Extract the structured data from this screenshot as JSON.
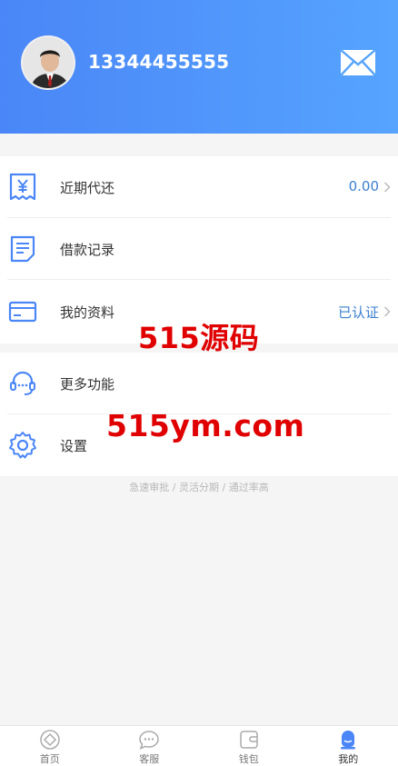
{
  "header": {
    "phone": "13344455555"
  },
  "menu_group_1": [
    {
      "label": "近期代还",
      "value": "0.00",
      "icon": "yuan-receipt-icon",
      "chevron": true
    },
    {
      "label": "借款记录",
      "value": "",
      "icon": "document-icon",
      "chevron": false
    },
    {
      "label": "我的资料",
      "value": "已认证",
      "icon": "card-icon",
      "chevron": true
    }
  ],
  "menu_group_2": [
    {
      "label": "更多功能",
      "icon": "headset-icon"
    },
    {
      "label": "设置",
      "icon": "gear-icon"
    }
  ],
  "slogan": "急速审批 / 灵活分期 / 通过率高",
  "watermark": {
    "line1": "515源码",
    "line2": "515ym.com"
  },
  "tabbar": [
    {
      "label": "首页",
      "icon": "home-icon",
      "active": false
    },
    {
      "label": "客服",
      "icon": "chat-icon",
      "active": false
    },
    {
      "label": "钱包",
      "icon": "wallet-icon",
      "active": false
    },
    {
      "label": "我的",
      "icon": "user-icon",
      "active": true
    }
  ],
  "colors": {
    "header_start": "#4a86f7",
    "header_end": "#56a4ff",
    "accent": "#3a7fd0",
    "icon_blue": "#4a86f7",
    "watermark": "#e00000"
  }
}
